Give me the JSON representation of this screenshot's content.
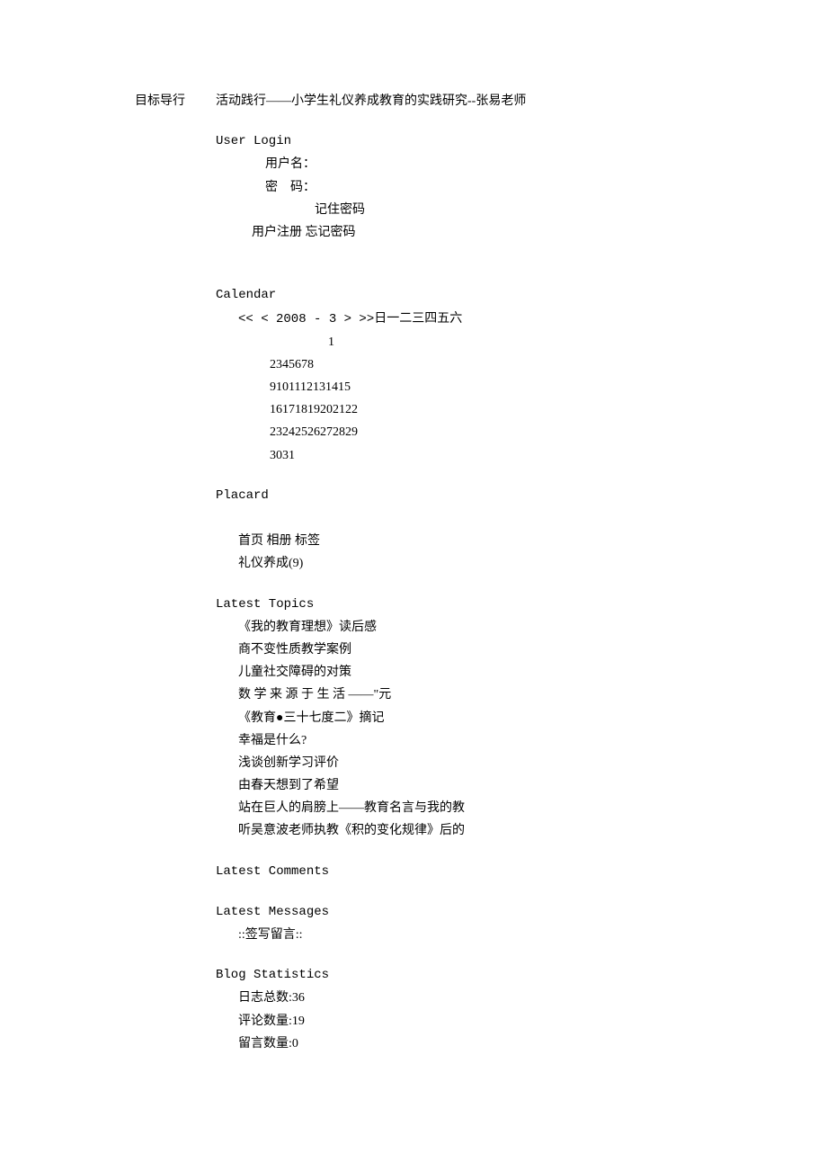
{
  "header": {
    "left_title": "目标导行",
    "right_title": "活动践行——小学生礼仪养成教育的实践研究--张易老师"
  },
  "login": {
    "section_title": "User Login",
    "username_label": "用户名：",
    "password_label": "密　码：",
    "remember_label": "记住密码",
    "register_link": "用户注册",
    "forgot_link": "忘记密码"
  },
  "calendar": {
    "section_title": "Calendar",
    "nav_line": "<<  < 2008 - 3 >  >>日一二三四五六",
    "rows": [
      "1",
      "2345678",
      "9101112131415",
      "16171819202122",
      "23242526272829",
      "3031"
    ]
  },
  "placard": {
    "section_title": "Placard"
  },
  "nav": {
    "home": "首页",
    "album": "相册",
    "tags": "标签",
    "category": "礼仪养成(9)"
  },
  "latest_topics": {
    "section_title": "Latest Topics",
    "items": [
      "《我的教育理想》读后感",
      "商不变性质教学案例",
      "儿童社交障碍的对策",
      "数 学 来 源 于 生 活 ——\"元",
      "《教育●三十七度二》摘记",
      "幸福是什么?",
      "浅谈创新学习评价",
      "由春天想到了希望",
      "站在巨人的肩膀上——教育名言与我的教",
      "听吴意波老师执教《积的变化规律》后的"
    ]
  },
  "latest_comments": {
    "section_title": "Latest Comments"
  },
  "latest_messages": {
    "section_title": "Latest Messages",
    "write_message": "::签写留言::"
  },
  "blog_stats": {
    "section_title": "Blog Statistics",
    "total_logs_label": "日志总数:",
    "total_logs_value": "36",
    "comments_label": "评论数量:",
    "comments_value": "19",
    "messages_label": "留言数量:",
    "messages_value": "0"
  }
}
